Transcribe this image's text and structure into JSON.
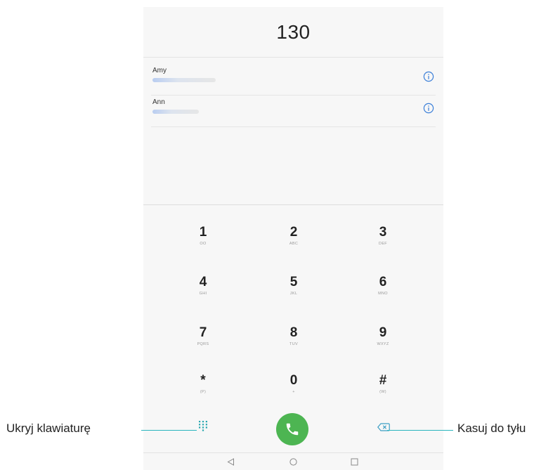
{
  "dialer": {
    "number": "130",
    "contacts": [
      {
        "name": "Amy"
      },
      {
        "name": "Ann"
      }
    ],
    "keys": [
      {
        "digit": "1",
        "letters": "OO"
      },
      {
        "digit": "2",
        "letters": "ABC"
      },
      {
        "digit": "3",
        "letters": "DEF"
      },
      {
        "digit": "4",
        "letters": "GHI"
      },
      {
        "digit": "5",
        "letters": "JKL"
      },
      {
        "digit": "6",
        "letters": "MNO"
      },
      {
        "digit": "7",
        "letters": "PQRS"
      },
      {
        "digit": "8",
        "letters": "TUV"
      },
      {
        "digit": "9",
        "letters": "WXYZ"
      },
      {
        "digit": "*",
        "letters": "(P)"
      },
      {
        "digit": "0",
        "letters": "+"
      },
      {
        "digit": "#",
        "letters": "(W)"
      }
    ]
  },
  "callouts": {
    "hide_keypad": "Ukryj klawiaturę",
    "backspace": "Kasuj do tyłu"
  },
  "icons": {
    "info": "info-icon",
    "dialpad": "dialpad-icon",
    "call": "phone-icon",
    "backspace": "backspace-icon",
    "nav_back": "back-triangle-icon",
    "nav_home": "home-circle-icon",
    "nav_recent": "recent-square-icon"
  },
  "colors": {
    "call_green": "#4db552",
    "accent_blue": "#3b7fd8",
    "callout_line": "#29b5bd"
  }
}
